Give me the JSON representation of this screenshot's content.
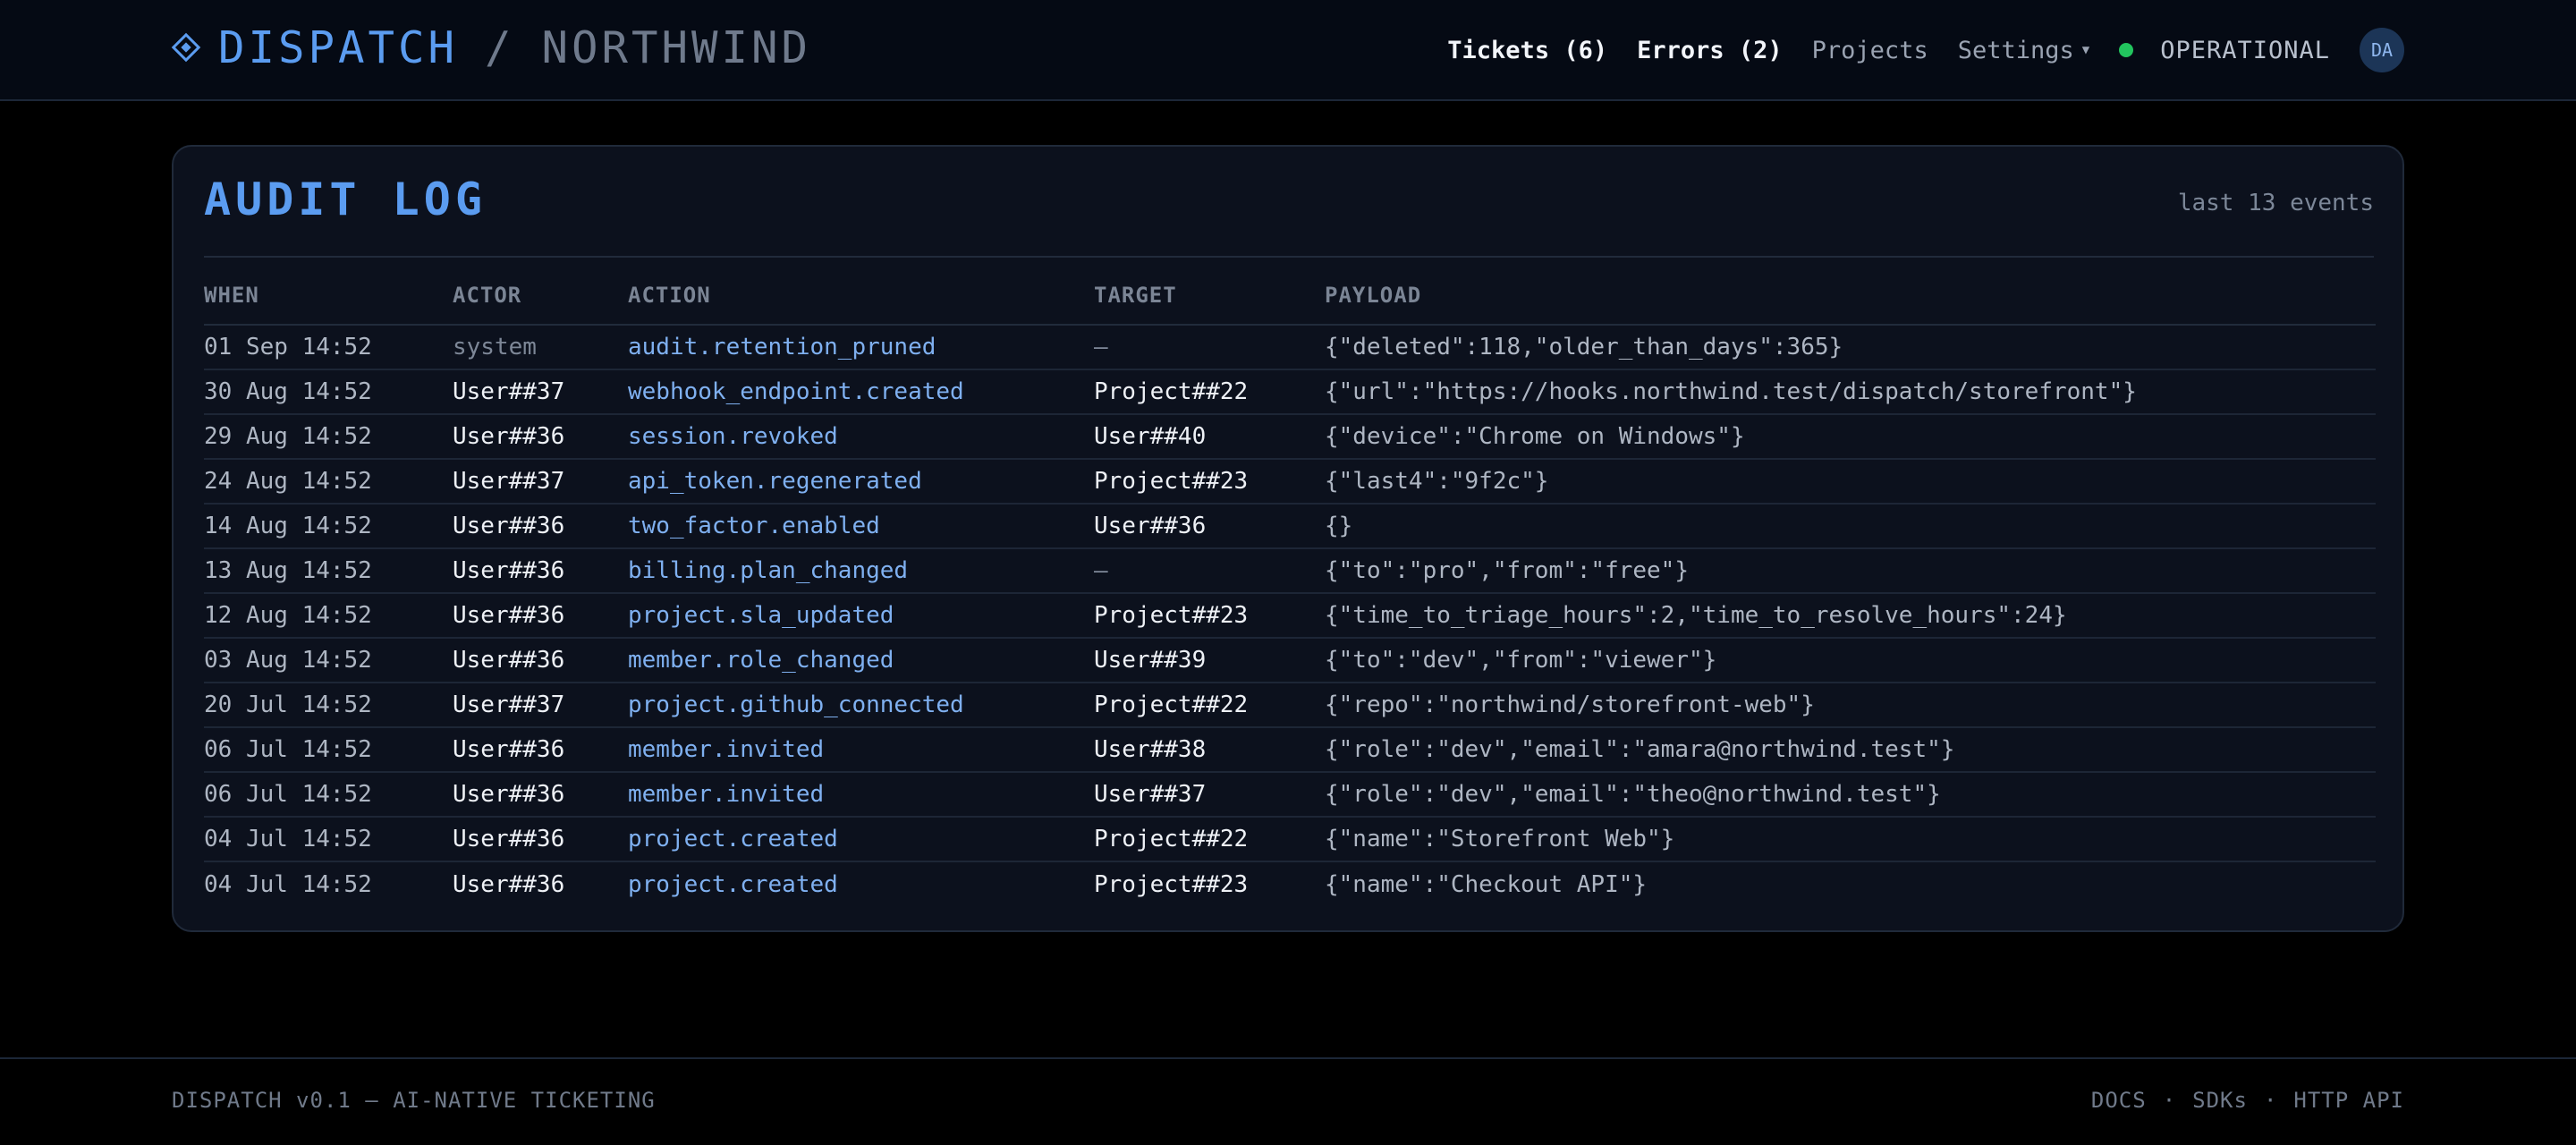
{
  "header": {
    "brand_name": "DISPATCH",
    "separator": "/",
    "org_name": "NORTHWIND",
    "nav": {
      "tickets": "Tickets (6)",
      "errors": "Errors (2)",
      "projects": "Projects",
      "settings": "Settings",
      "status": "OPERATIONAL",
      "avatar": "DA"
    },
    "status_color": "#22c55e",
    "accent_color": "#5b9cf0"
  },
  "panel": {
    "title": "AUDIT LOG",
    "meta": "last 13 events",
    "columns": {
      "when": "WHEN",
      "actor": "ACTOR",
      "action": "ACTION",
      "target": "TARGET",
      "payload": "PAYLOAD"
    },
    "rows": [
      {
        "when": "01 Sep 14:52",
        "actor": "system",
        "action": "audit.retention_pruned",
        "target": "—",
        "payload": "{\"deleted\":118,\"older_than_days\":365}"
      },
      {
        "when": "30 Aug 14:52",
        "actor": "User##37",
        "action": "webhook_endpoint.created",
        "target": "Project##22",
        "payload": "{\"url\":\"https://hooks.northwind.test/dispatch/storefront\"}"
      },
      {
        "when": "29 Aug 14:52",
        "actor": "User##36",
        "action": "session.revoked",
        "target": "User##40",
        "payload": "{\"device\":\"Chrome on Windows\"}"
      },
      {
        "when": "24 Aug 14:52",
        "actor": "User##37",
        "action": "api_token.regenerated",
        "target": "Project##23",
        "payload": "{\"last4\":\"9f2c\"}"
      },
      {
        "when": "14 Aug 14:52",
        "actor": "User##36",
        "action": "two_factor.enabled",
        "target": "User##36",
        "payload": "{}"
      },
      {
        "when": "13 Aug 14:52",
        "actor": "User##36",
        "action": "billing.plan_changed",
        "target": "—",
        "payload": "{\"to\":\"pro\",\"from\":\"free\"}"
      },
      {
        "when": "12 Aug 14:52",
        "actor": "User##36",
        "action": "project.sla_updated",
        "target": "Project##23",
        "payload": "{\"time_to_triage_hours\":2,\"time_to_resolve_hours\":24}"
      },
      {
        "when": "03 Aug 14:52",
        "actor": "User##36",
        "action": "member.role_changed",
        "target": "User##39",
        "payload": "{\"to\":\"dev\",\"from\":\"viewer\"}"
      },
      {
        "when": "20 Jul 14:52",
        "actor": "User##37",
        "action": "project.github_connected",
        "target": "Project##22",
        "payload": "{\"repo\":\"northwind/storefront-web\"}"
      },
      {
        "when": "06 Jul 14:52",
        "actor": "User##36",
        "action": "member.invited",
        "target": "User##38",
        "payload": "{\"role\":\"dev\",\"email\":\"amara@northwind.test\"}"
      },
      {
        "when": "06 Jul 14:52",
        "actor": "User##36",
        "action": "member.invited",
        "target": "User##37",
        "payload": "{\"role\":\"dev\",\"email\":\"theo@northwind.test\"}"
      },
      {
        "when": "04 Jul 14:52",
        "actor": "User##36",
        "action": "project.created",
        "target": "Project##22",
        "payload": "{\"name\":\"Storefront Web\"}"
      },
      {
        "when": "04 Jul 14:52",
        "actor": "User##36",
        "action": "project.created",
        "target": "Project##23",
        "payload": "{\"name\":\"Checkout API\"}"
      }
    ]
  },
  "footer": {
    "left": "DISPATCH v0.1 — AI-NATIVE TICKETING",
    "links": [
      "DOCS",
      "SDKs",
      "HTTP API"
    ],
    "link_separator": "·"
  }
}
